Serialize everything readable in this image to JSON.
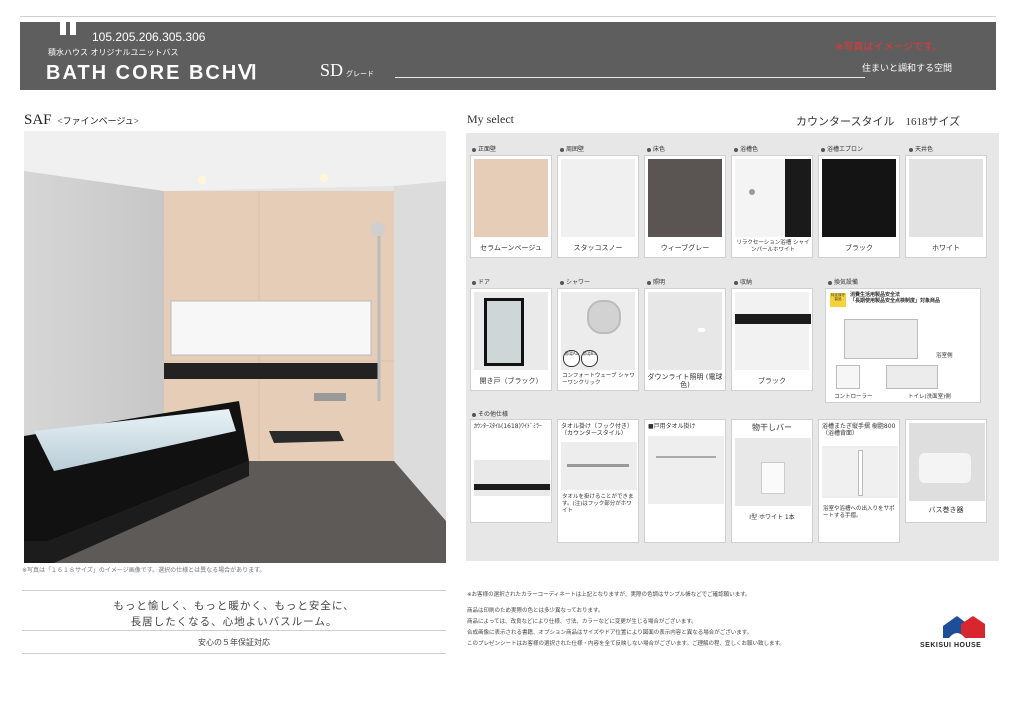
{
  "header": {
    "numbers": "105.205.206.305.306",
    "subtitle": "積水ハウス オリジナルユニットバス",
    "title": "BATH CORE BCHⅥ",
    "grade": "SD",
    "grade_label": "グレード",
    "note": "※写真はイメージです。",
    "tagline": "住まいと調和する空間"
  },
  "left": {
    "model": "SAF",
    "model_sub": "<ファインベージュ>",
    "photo_caption": "※写真は「１６１８サイズ」のイメージ画像です。選択の仕様とは異なる場合があります。",
    "tagline_1": "もっと愉しく、もっと暖かく、もっと安全に、",
    "tagline_2": "長居したくなる、心地よいバスルーム。",
    "warranty": "安心の５年保証対応"
  },
  "right": {
    "heading": "My select",
    "counter": "カウンタースタイル　1618サイズ",
    "row1": [
      {
        "label": "正面壁",
        "caption": "セラムーンベージュ",
        "color": "#e6cdb8"
      },
      {
        "label": "周囲壁",
        "caption": "スタッコスノー",
        "color": "#ededed"
      },
      {
        "label": "床色",
        "caption": "ウィーブグレー",
        "color": "#5a5552"
      },
      {
        "label": "浴槽色",
        "caption": "リラクセーション浴槽 シャインパールホワイト",
        "color": "#1a1a1a"
      },
      {
        "label": "浴槽エプロン",
        "caption": "ブラック",
        "color": "#141414"
      },
      {
        "label": "天井色",
        "caption": "ホワイト",
        "color": "#e2e2e2"
      }
    ],
    "row2": [
      {
        "label": "ドア",
        "caption": "開き戸（ブラック）"
      },
      {
        "label": "シャワー",
        "caption": "コンフォートウェーブ シャワーワンクリック",
        "badge_1": "節湯A1",
        "badge_2": "節湯B1"
      },
      {
        "label": "照明",
        "caption": "ダウンライト照明 (電球色)"
      },
      {
        "label": "収納",
        "caption": "ブラック"
      },
      {
        "label": "換気設備",
        "badge": "特定保守製品",
        "title_1": "消費生活用製品安全法",
        "title_2": "「長期使用製品安全点検制度」対象商品",
        "label_bath": "浴室側",
        "label_ctrl": "コントローラー",
        "label_toilet": "トイレ(洗面室)側"
      }
    ],
    "row3_label": "その他仕様",
    "row3": [
      {
        "top": "ｶｳﾝﾀｰｽﾀｲﾙ(1618)ﾜｲﾄﾞﾐﾗｰ",
        "caption": ""
      },
      {
        "top": "タオル掛け（フック付き）（カウンタースタイル）",
        "caption": "タオルを掛けることができます。(注)はフック部分がホワイト"
      },
      {
        "top": "■戸用タオル掛け",
        "caption": ""
      },
      {
        "top": "物干しバー",
        "caption": "I型 ホワイト 1本"
      },
      {
        "top": "浴槽またぎ縦手摺 樹脂800（浴槽背面）",
        "caption": "浴室や浴槽への出入りをサポートする手摺。"
      },
      {
        "top": "",
        "caption": "バス巻き器"
      }
    ],
    "notes": [
      "※お客様の選択されたカラーコーディネートは上記となりますが、実際の色調はサンプル帳などでご確認願います。",
      "商品は印刷のため実際の色とは多少異なっております。",
      "商品によっては、改良などにより仕様、寸法、カラーなどに変更が生じる場合がございます。",
      "合成画像に表示される書籍、オプション商品はサイズやドア位置により図面の表示内容と異なる場合がございます。",
      "このプレゼンシートはお客様の選択された仕様・内容を全て反映しない場合がございます。ご理解の程、宜しくお願い致します。"
    ]
  },
  "brand": {
    "name": "SEKISUI HOUSE",
    "color_red": "#d7262d",
    "color_blue": "#1d4e9a"
  }
}
